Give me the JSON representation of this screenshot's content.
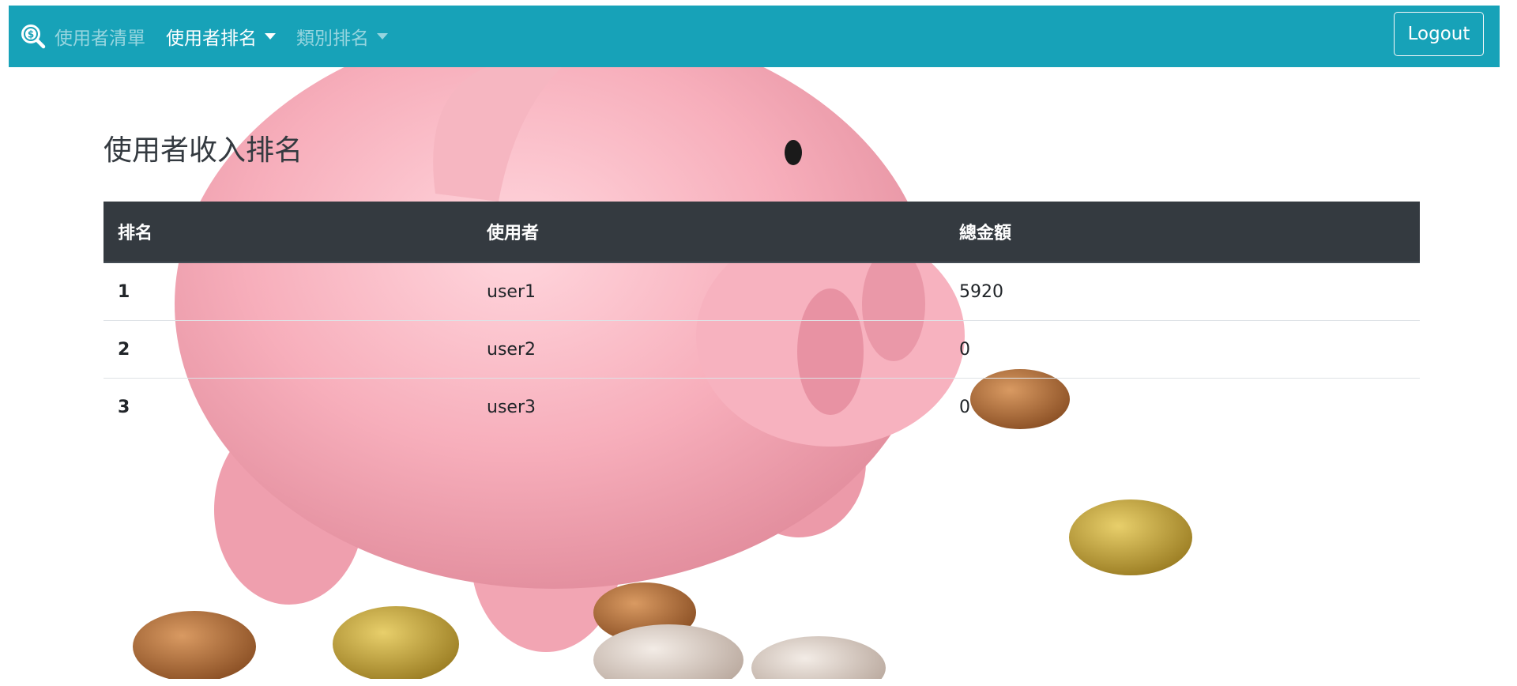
{
  "navbar": {
    "brand_icon": "search-dollar-icon",
    "items": [
      {
        "label": "使用者清單",
        "active": false,
        "dropdown": false
      },
      {
        "label": "使用者排名",
        "active": true,
        "dropdown": true
      },
      {
        "label": "類別排名",
        "active": false,
        "dropdown": true
      }
    ],
    "logout_label": "Logout",
    "color": "#17a2b8"
  },
  "page": {
    "title": "使用者收入排名"
  },
  "table": {
    "headers": [
      "排名",
      "使用者",
      "總金額"
    ],
    "rows": [
      {
        "rank": "1",
        "user": "user1",
        "amount": "5920"
      },
      {
        "rank": "2",
        "user": "user2",
        "amount": "0"
      },
      {
        "rank": "3",
        "user": "user3",
        "amount": "0"
      }
    ]
  },
  "background": {
    "image": "piggy-bank-with-coins",
    "pig_color": "#f4a6b3"
  }
}
